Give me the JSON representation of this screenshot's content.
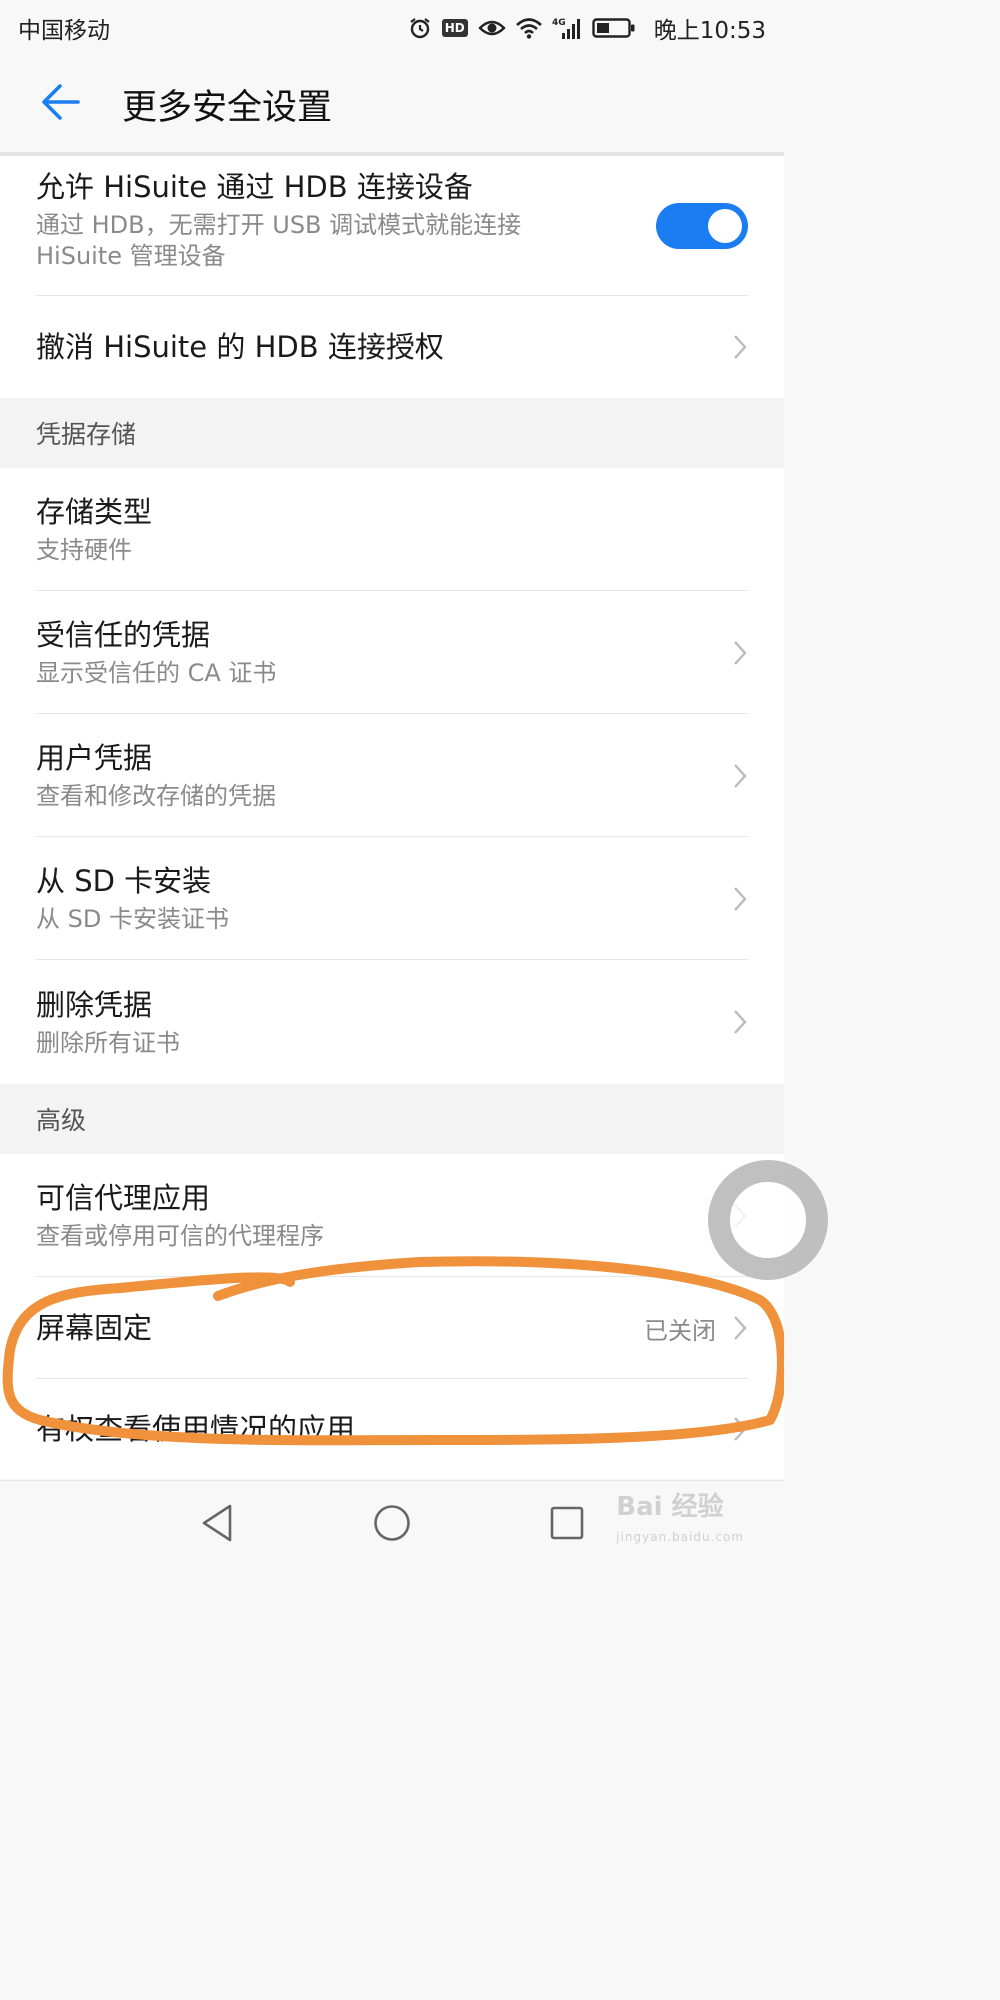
{
  "status_bar": {
    "carrier": "中国移动",
    "hd": "HD",
    "network": "4G",
    "time": "晚上10:53"
  },
  "header": {
    "title": "更多安全设置"
  },
  "hdb_section": {
    "allow_hdb": {
      "title": "允许 HiSuite 通过 HDB 连接设备",
      "subtitle": "通过 HDB，无需打开 USB 调试模式就能连接 HiSuite 管理设备",
      "toggle_on": true
    },
    "revoke_hdb": {
      "title": "撤消 HiSuite 的 HDB 连接授权"
    }
  },
  "credential_storage": {
    "header": "凭据存储",
    "items": [
      {
        "title": "存储类型",
        "subtitle": "支持硬件",
        "has_chevron": false
      },
      {
        "title": "受信任的凭据",
        "subtitle": "显示受信任的 CA 证书",
        "has_chevron": true
      },
      {
        "title": "用户凭据",
        "subtitle": "查看和修改存储的凭据",
        "has_chevron": true
      },
      {
        "title": "从 SD 卡安装",
        "subtitle": "从 SD 卡安装证书",
        "has_chevron": true
      },
      {
        "title": "删除凭据",
        "subtitle": "删除所有证书",
        "has_chevron": true
      }
    ]
  },
  "advanced": {
    "header": "高级",
    "trust_agents": {
      "title": "可信代理应用",
      "subtitle": "查看或停用可信的代理程序"
    },
    "screen_pinning": {
      "title": "屏幕固定",
      "value": "已关闭"
    },
    "usage_access": {
      "title": "有权查看使用情况的应用"
    }
  },
  "watermark": {
    "brand": "Bai 经验",
    "url": "jingyan.baidu.com"
  },
  "colors": {
    "accent": "#1a7ef2",
    "annotation": "#f0913c"
  },
  "icons": {
    "back": "arrow-left",
    "chevron": "chevron-right",
    "nav_back": "triangle-left",
    "nav_home": "circle",
    "nav_recents": "square"
  }
}
